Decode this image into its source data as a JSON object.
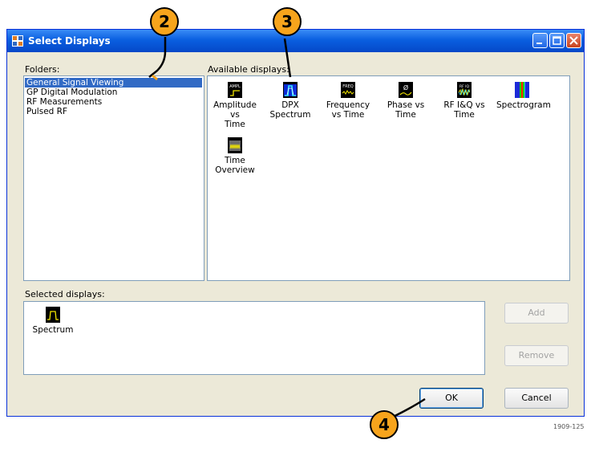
{
  "window": {
    "title": "Select Displays",
    "controls": {
      "minimize": "minimize",
      "maximize": "maximize",
      "close": "close"
    }
  },
  "folders": {
    "label": "Folders:",
    "items": [
      "General Signal Viewing",
      "GP Digital Modulation",
      "RF Measurements",
      "Pulsed RF"
    ],
    "selected_index": 0
  },
  "available": {
    "label": "Available displays:",
    "items": [
      {
        "line1": "Amplitude vs",
        "line2": "Time",
        "icon": "ampl-time-icon",
        "badge": "AMPL"
      },
      {
        "line1": "DPX",
        "line2": "Spectrum",
        "icon": "dpx-spectrum-icon",
        "badge": ""
      },
      {
        "line1": "Frequency",
        "line2": "vs Time",
        "icon": "freq-time-icon",
        "badge": "FREQ"
      },
      {
        "line1": "Phase vs",
        "line2": "Time",
        "icon": "phase-time-icon",
        "badge": "Ø"
      },
      {
        "line1": "RF I&Q vs",
        "line2": "Time",
        "icon": "rf-iq-time-icon",
        "badge": "RF IQ"
      },
      {
        "line1": "Spectrogram",
        "line2": "",
        "icon": "spectrogram-icon",
        "badge": ""
      },
      {
        "line1": "Time",
        "line2": "Overview",
        "icon": "time-overview-icon",
        "badge": ""
      }
    ]
  },
  "selected": {
    "label": "Selected displays:",
    "items": [
      {
        "caption": "Spectrum",
        "icon": "spectrum-icon"
      }
    ]
  },
  "buttons": {
    "add": "Add",
    "remove": "Remove",
    "ok": "OK",
    "cancel": "Cancel"
  },
  "callouts": [
    "2",
    "3",
    "4"
  ],
  "figure_id": "1909-125",
  "colors": {
    "selection": "#316ac5",
    "callout": "#f7a41c",
    "titlebar": "#0a5fe0",
    "trace": "#f2e600"
  }
}
